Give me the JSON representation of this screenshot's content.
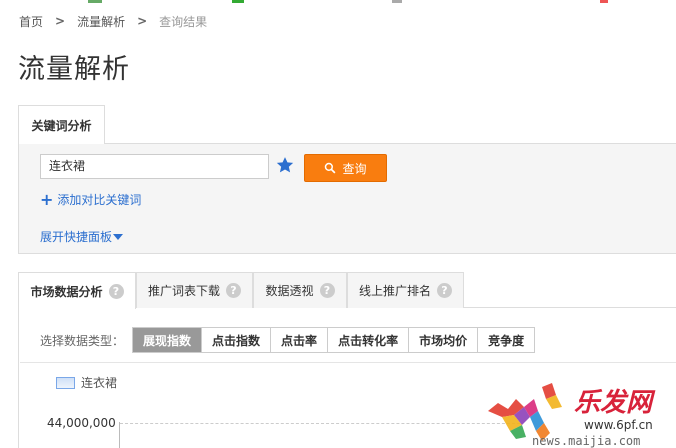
{
  "breadcrumb": {
    "items": [
      "首页",
      "流量解析",
      "查询结果"
    ]
  },
  "page": {
    "title": "流量解析"
  },
  "keyword_panel": {
    "tab_label": "关键词分析",
    "input_value": "连衣裙",
    "query_label": "查询",
    "add_compare_label": "添加对比关键词",
    "expand_label": "展开快捷面板"
  },
  "tabs": [
    {
      "label": "市场数据分析",
      "active": true
    },
    {
      "label": "推广词表下载",
      "active": false
    },
    {
      "label": "数据透视",
      "active": false
    },
    {
      "label": "线上推广排名",
      "active": false
    }
  ],
  "data_type": {
    "label": "选择数据类型：",
    "options": [
      {
        "label": "展现指数",
        "active": true
      },
      {
        "label": "点击指数",
        "active": false
      },
      {
        "label": "点击率",
        "active": false
      },
      {
        "label": "点击转化率",
        "active": false
      },
      {
        "label": "市场均价",
        "active": false
      },
      {
        "label": "竞争度",
        "active": false
      }
    ]
  },
  "chart": {
    "legend": "连衣裙",
    "y_tick_top": "44,000,000"
  },
  "watermark": {
    "brand": "乐发网",
    "url": "news.maijia.com",
    "url2": "www.6pf.cn"
  },
  "colors": {
    "accent_orange": "#f97d0f",
    "link_blue": "#2c6fcf",
    "active_type_gray": "#999999"
  }
}
